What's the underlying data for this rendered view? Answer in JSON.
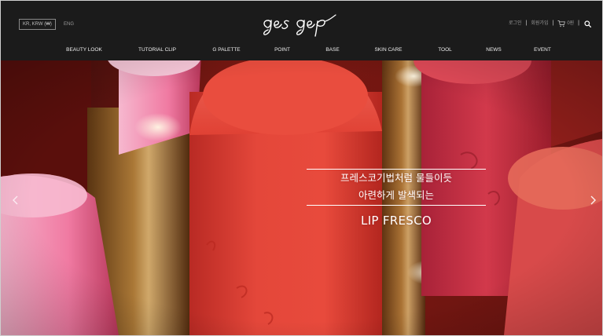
{
  "header": {
    "locale_label": "KR, KRW (₩)",
    "lang_link": "ENG",
    "logo_alt": "gesgep",
    "utility": {
      "login": "로그인",
      "signup": "회원가입",
      "cart": "0원",
      "search_icon": "search-icon",
      "cart_icon": "cart-icon"
    }
  },
  "nav": {
    "items": [
      "BEAUTY LOOK",
      "TUTORIAL CLIP",
      "G PALETTE",
      "POINT",
      "BASE",
      "SKIN CARE",
      "TOOL",
      "NEWS",
      "EVENT"
    ]
  },
  "hero": {
    "headline_line1": "프레스코기법처럼 물들이듯",
    "headline_line2": "아련하게 발색되는",
    "subtitle": "LIP FRESCO",
    "prev_icon": "chevron-left-icon",
    "next_icon": "chevron-right-icon"
  },
  "colors": {
    "header_bg": "#1b1b1b",
    "nav_text": "#f0f0f0",
    "hero_red": "#e2483c",
    "hero_pink": "#f07aa2"
  }
}
